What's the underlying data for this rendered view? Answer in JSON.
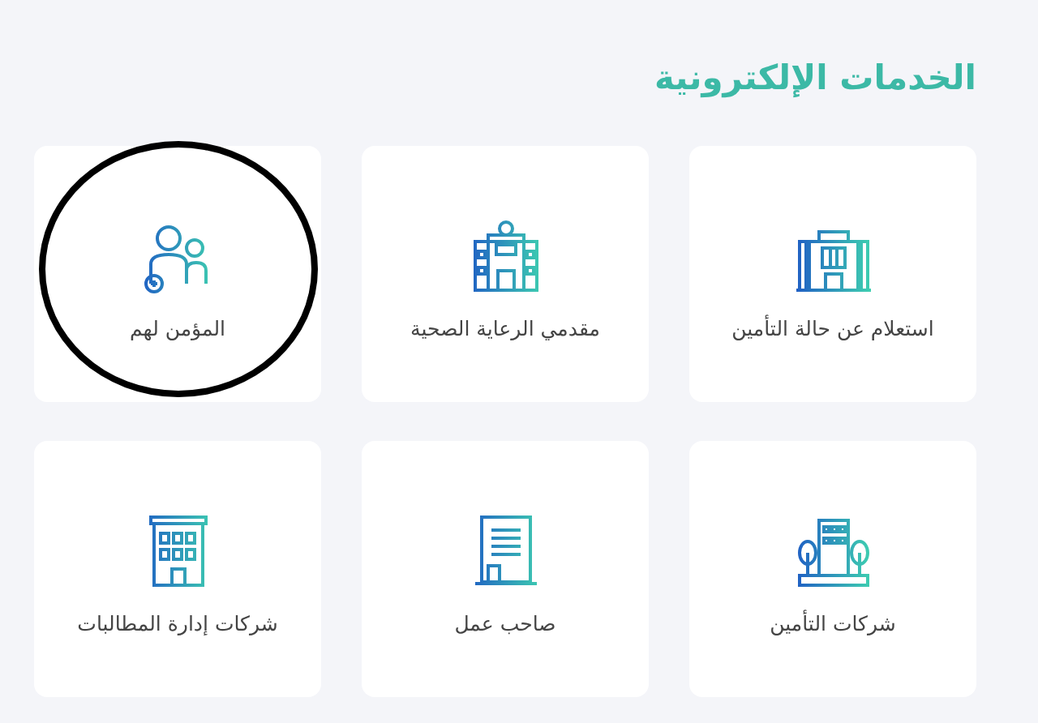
{
  "section": {
    "title": "الخدمات الإلكترونية"
  },
  "services": [
    {
      "label": "استعلام عن حالة التأمين",
      "circled": false
    },
    {
      "label": "مقدمي الرعاية الصحية",
      "circled": false
    },
    {
      "label": "المؤمن لهم",
      "circled": true
    },
    {
      "label": "شركات التأمين",
      "circled": false
    },
    {
      "label": "صاحب عمل",
      "circled": false
    },
    {
      "label": "شركات إدارة المطالبات",
      "circled": false
    }
  ]
}
